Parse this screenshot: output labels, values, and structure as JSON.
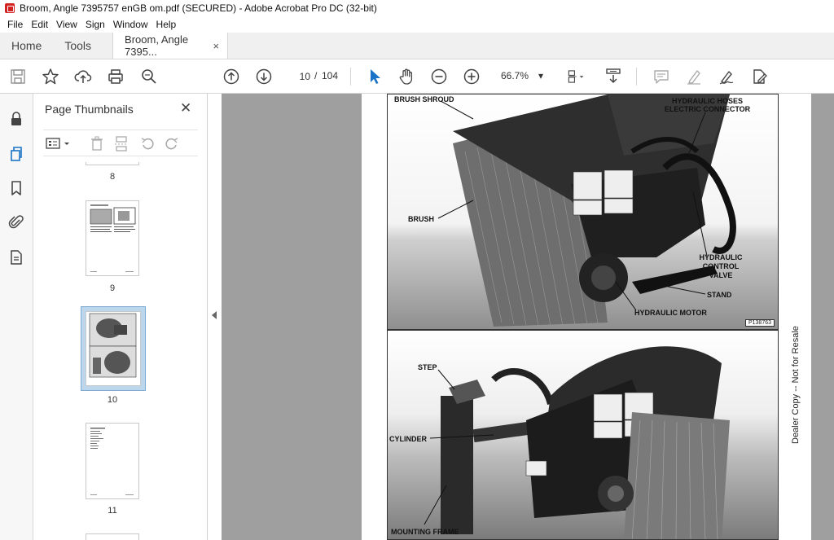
{
  "window": {
    "title": "Broom, Angle 7395757 enGB om.pdf (SECURED) - Adobe Acrobat Pro DC (32-bit)"
  },
  "menu": [
    "File",
    "Edit",
    "View",
    "Sign",
    "Window",
    "Help"
  ],
  "tabs": {
    "home": "Home",
    "tools": "Tools",
    "document": "Broom, Angle 7395...",
    "close_glyph": "×"
  },
  "toolbar": {
    "current_page": "10",
    "separator": "/",
    "total_pages": "104",
    "zoom": "66.7%",
    "zoom_caret": "▾"
  },
  "thumbnails_panel": {
    "title": "Page Thumbnails",
    "close_glyph": "✕",
    "pages": [
      {
        "label": "8"
      },
      {
        "label": "9"
      },
      {
        "label": "10",
        "selected": true
      },
      {
        "label": "11"
      }
    ]
  },
  "document": {
    "photo1_callouts": {
      "brush_shroud": "BRUSH SHROUD",
      "hydraulic_hoses": "HYDRAULIC HOSES",
      "electric_connector": "ELECTRIC CONNECTOR",
      "brush": "BRUSH",
      "hydraulic_control_valve_1": "HYDRAULIC",
      "hydraulic_control_valve_2": "CONTROL",
      "hydraulic_control_valve_3": "VALVE",
      "stand": "STAND",
      "hydraulic_motor": "HYDRAULIC MOTOR",
      "photo_code": "P138763"
    },
    "photo2_callouts": {
      "step": "STEP",
      "cylinder": "CYLINDER",
      "mounting_frame": "MOUNTING FRAME"
    },
    "side_text": "Dealer Copy -- Not for Resale"
  },
  "colors": {
    "accent_blue": "#1a73c7",
    "doc_background": "#9f9f9f",
    "selection": "#bcd6ec"
  }
}
